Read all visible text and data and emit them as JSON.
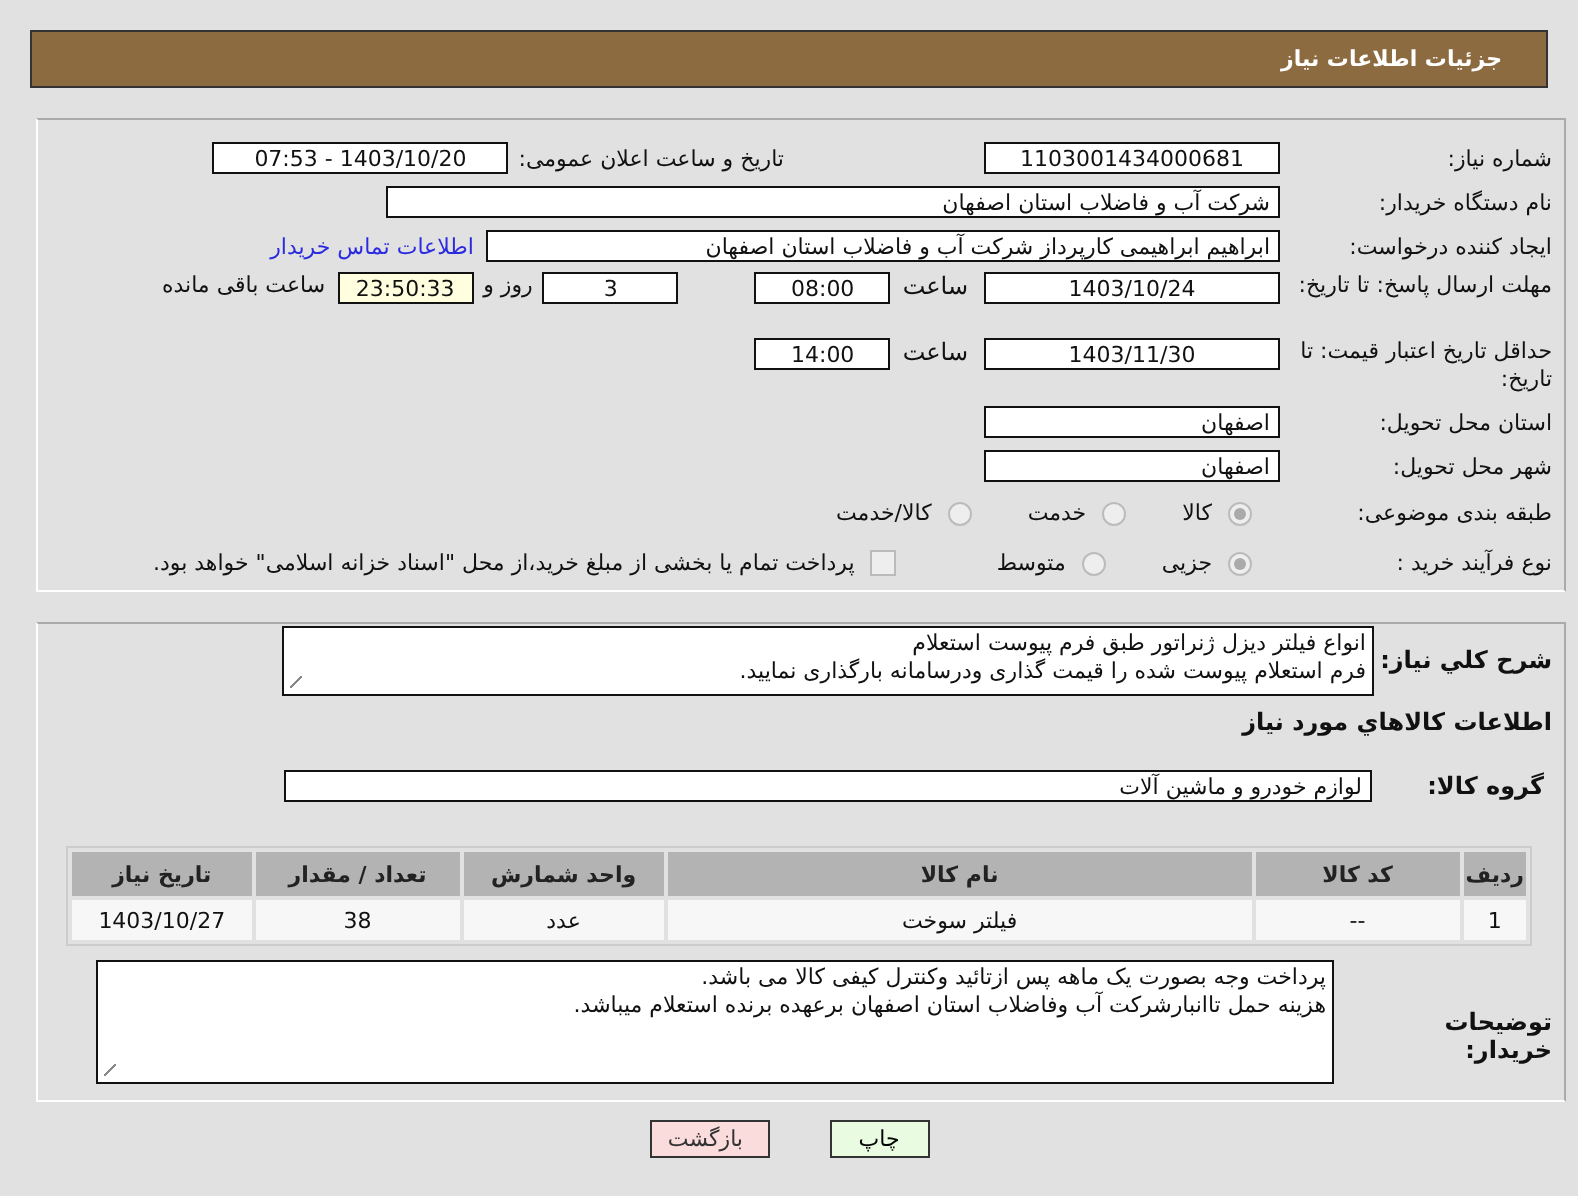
{
  "header": {
    "title": "جزئیات اطلاعات نیاز"
  },
  "need_number": {
    "label": "شماره نیاز:",
    "value": "1103001434000681"
  },
  "announce": {
    "label": "تاریخ و ساعت اعلان عمومی:",
    "value": "1403/10/20 - 07:53"
  },
  "buyer_org": {
    "label": "نام دستگاه خریدار:",
    "value": "شرکت آب و فاضلاب استان اصفهان"
  },
  "creator": {
    "label": "ایجاد کننده درخواست:",
    "value": "ابراهیم ابراهیمی کارپرداز شرکت آب و فاضلاب استان اصفهان",
    "link": "اطلاعات تماس خریدار"
  },
  "deadline": {
    "label": "مهلت ارسال پاسخ: تا تاریخ:",
    "date": "1403/10/24",
    "time_label": "ساعت",
    "time": "08:00",
    "days": "3",
    "days_label": "روز و",
    "remaining": "23:50:33",
    "remaining_label": "ساعت باقی مانده"
  },
  "validity": {
    "label": "حداقل تاریخ اعتبار قیمت: تا تاریخ:",
    "date": "1403/11/30",
    "time_label": "ساعت",
    "time": "14:00"
  },
  "province": {
    "label": "استان محل تحویل:",
    "value": "اصفهان"
  },
  "city": {
    "label": "شهر محل تحویل:",
    "value": "اصفهان"
  },
  "category": {
    "label": "طبقه بندی موضوعی:",
    "options": [
      {
        "label": "کالا",
        "selected": true
      },
      {
        "label": "خدمت",
        "selected": false
      },
      {
        "label": "کالا/خدمت",
        "selected": false
      }
    ]
  },
  "process": {
    "label": "نوع فرآیند خرید :",
    "options": [
      {
        "label": "جزیی",
        "selected": true
      },
      {
        "label": "متوسط",
        "selected": false
      }
    ],
    "treasury": {
      "label": "پرداخت تمام یا بخشی از مبلغ خرید،از محل \"اسناد خزانه اسلامی\" خواهد بود.",
      "checked": false
    }
  },
  "description": {
    "label": "شرح كلي نياز:",
    "value": "انواع فیلتر دیزل ژنراتور طبق فرم پیوست استعلام\nفرم استعلام پیوست شده را قیمت گذاری ودرسامانه بارگذاری نمایید."
  },
  "items_heading": "اطلاعات كالاهاي مورد نياز",
  "goods_group": {
    "label": "گروه كالا:",
    "value": "لوازم خودرو و ماشین آلات"
  },
  "table": {
    "columns": [
      "ردیف",
      "کد کالا",
      "نام کالا",
      "واحد شمارش",
      "تعداد / مقدار",
      "تاریخ نیاز"
    ],
    "rows": [
      [
        "1",
        "--",
        "فیلتر سوخت",
        "عدد",
        "38",
        "1403/10/27"
      ]
    ]
  },
  "buyer_notes": {
    "label": "توضیحات خریدار:",
    "value": "پرداخت وجه بصورت یک ماهه پس ازتائید وکنترل کیفی کالا می باشد.\nهزینه حمل تاانبارشرکت آب وفاضلاب استان اصفهان برعهده برنده استعلام میباشد."
  },
  "buttons": [
    {
      "label": "چاپ",
      "kind": "print"
    },
    {
      "label": "بازگشت",
      "kind": "back"
    }
  ]
}
